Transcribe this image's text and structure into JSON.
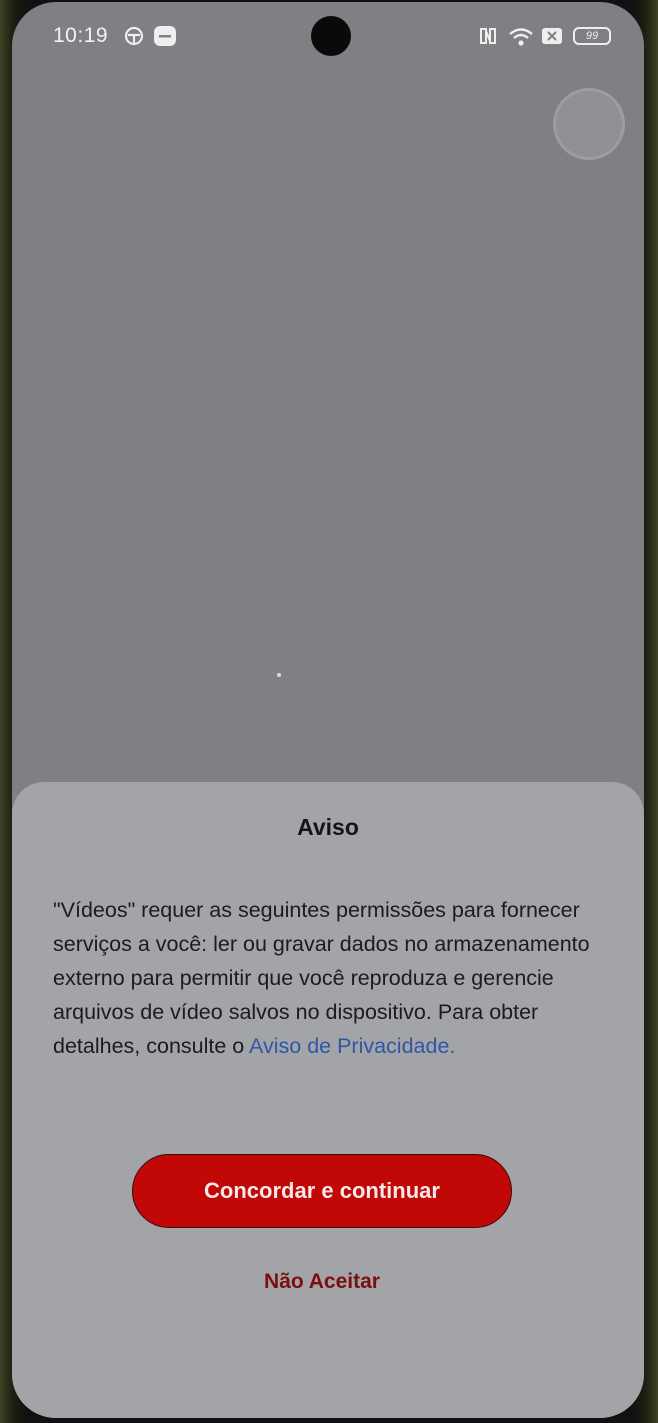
{
  "status_bar": {
    "time": "10:19",
    "battery": "99",
    "left_icons": [
      "shield-app-icon",
      "app-notification-icon"
    ],
    "right_icons": [
      "nfc-icon",
      "wifi-icon",
      "sim-off-icon",
      "battery-icon"
    ]
  },
  "dialog": {
    "title": "Aviso",
    "body_text": "\"Vídeos\" requer as seguintes permissões para fornecer serviços a você: ler ou gravar dados no armazenamento externo para permitir que você reproduza e gerencie arquivos de vídeo salvos no dispositivo. Para obter detalhes, consulte o ",
    "privacy_link": "Aviso de Privacidade",
    "body_end": ".",
    "agree_label": "Concordar e continuar",
    "decline_label": "Não Aceitar"
  },
  "colors": {
    "overlay_background": "#7f8083",
    "sheet_background": "#a3a4a8",
    "primary_button": "#c20707",
    "link": "#2f56a8",
    "decline_text": "#7a0f0f"
  }
}
